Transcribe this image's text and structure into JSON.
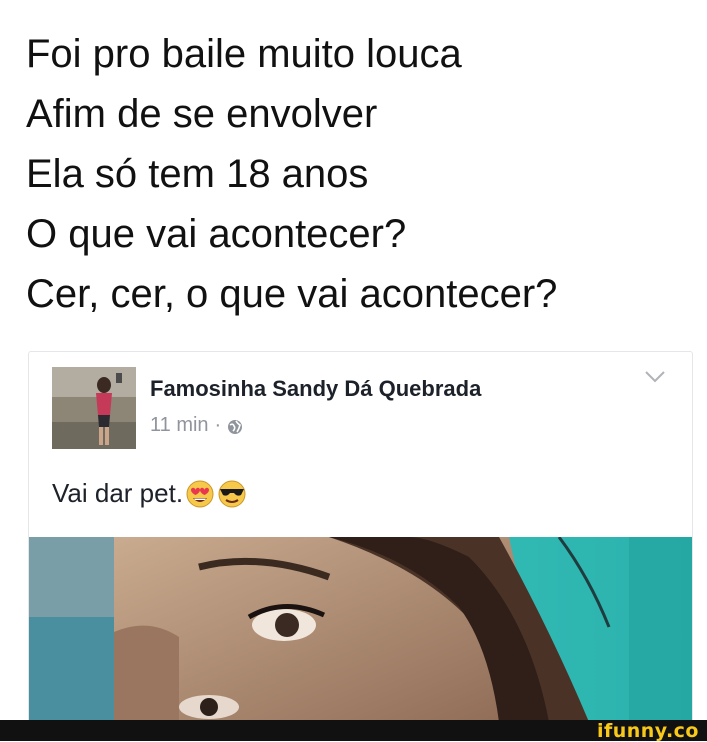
{
  "caption": {
    "lines": [
      "Foi pro baile muito louca",
      "Afim de se envolver",
      "Ela só tem 18 anos",
      "O que vai acontecer?",
      "Cer, cer, o que vai acontecer?"
    ]
  },
  "post": {
    "author": "Famosinha Sandy Dá Quebrada",
    "time": "11 min",
    "separator": "·",
    "privacy_icon": "globe-icon",
    "menu_icon": "chevron-down-icon",
    "text": "Vai dar pet.",
    "emojis": [
      "heart-eyes-emoji",
      "sunglasses-emoji"
    ]
  },
  "watermark": "ifunny.co",
  "colors": {
    "caption_text": "#111111",
    "author_text": "#1d2129",
    "meta_text": "#90949c",
    "bottom_bar": "#111111",
    "watermark": "#f9c91a"
  }
}
